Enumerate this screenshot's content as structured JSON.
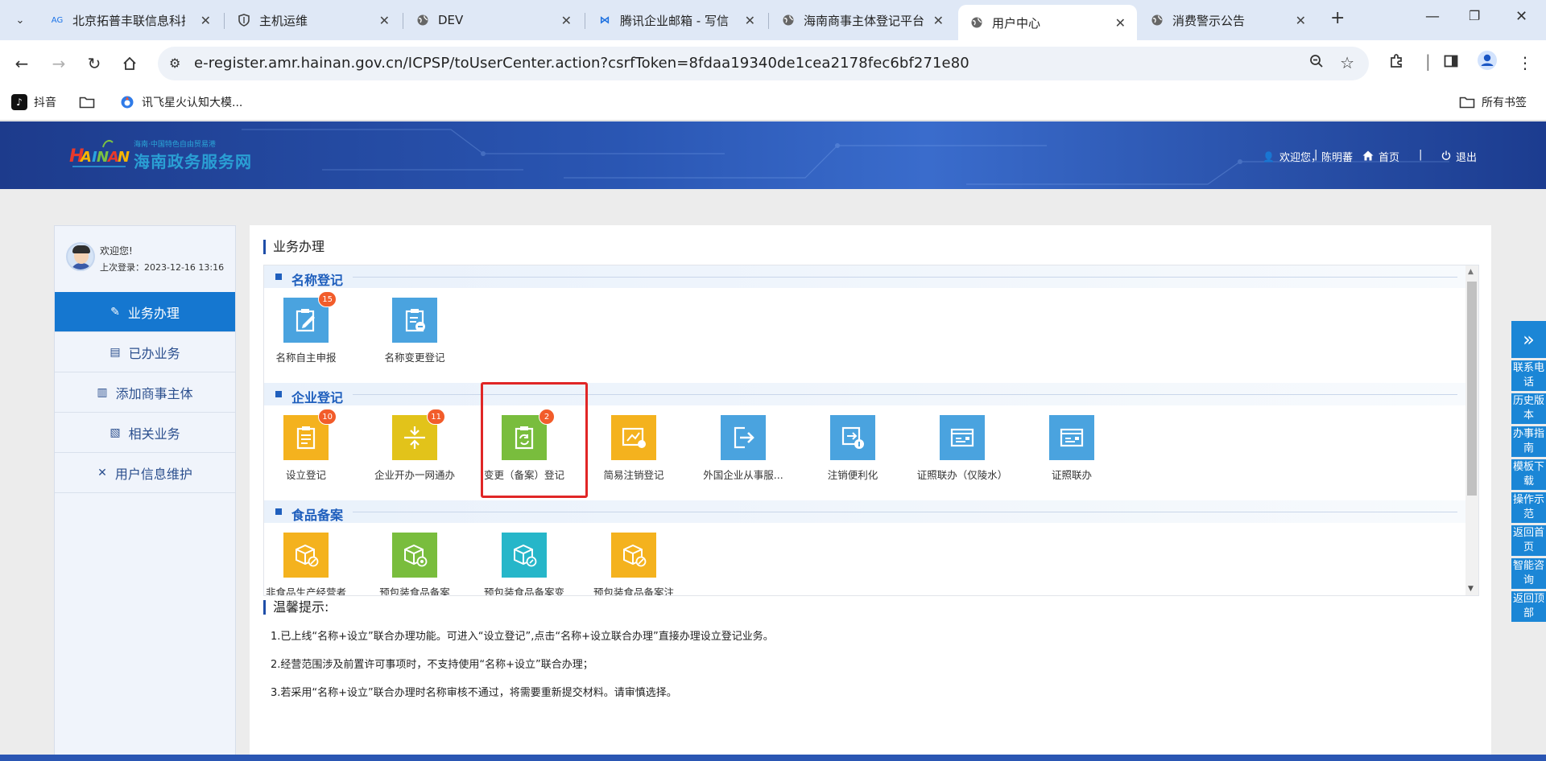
{
  "browser": {
    "tabs": [
      {
        "title": "北京拓普丰联信息科技",
        "icon": "ai-icon"
      },
      {
        "title": "主机运维",
        "icon": "shield-icon"
      },
      {
        "title": "DEV",
        "icon": "globe-icon"
      },
      {
        "title": "腾讯企业邮箱 - 写信",
        "icon": "mail-icon"
      },
      {
        "title": "海南商事主体登记平台",
        "icon": "globe-icon"
      },
      {
        "title": "用户中心",
        "icon": "globe-icon",
        "active": true
      },
      {
        "title": "消费警示公告",
        "icon": "globe-icon"
      }
    ],
    "url": "e-register.amr.hainan.gov.cn/ICPSP/toUserCenter.action?csrfToken=8fdaa19340de1cea2178fec6bf271e80",
    "bookmarks": [
      "抖音",
      "",
      "讯飞星火认知大模..."
    ],
    "all_bookmarks": "所有书签"
  },
  "header": {
    "logo_small": "海南·中国特色自由贸易港",
    "logo_title": "海南政务服务网",
    "welcome": "欢迎您，陈明蕃",
    "home": "首页",
    "logout": "退出",
    "separator": "|"
  },
  "sidebar": {
    "hello": "欢迎您!",
    "last_login": "上次登录：2023-12-16 13:16",
    "items": [
      {
        "label": "业务办理",
        "active": true
      },
      {
        "label": "已办业务"
      },
      {
        "label": "添加商事主体"
      },
      {
        "label": "相关业务"
      },
      {
        "label": "用户信息维护"
      }
    ]
  },
  "content": {
    "title": "业务办理",
    "sections": [
      {
        "title": "名称登记",
        "items": [
          {
            "label": "名称自主申报",
            "badge": "15",
            "color": "#4aa3df"
          },
          {
            "label": "名称变更登记",
            "badge": "",
            "color": "#4aa3df"
          }
        ]
      },
      {
        "title": "企业登记",
        "items": [
          {
            "label": "设立登记",
            "badge": "10",
            "color": "#f4b21e"
          },
          {
            "label": "企业开办一网通办",
            "badge": "11",
            "color": "#e2c31a"
          },
          {
            "label": "变更（备案）登记",
            "badge": "2",
            "color": "#79bd3d"
          },
          {
            "label": "简易注销登记",
            "badge": "",
            "color": "#f4b21e"
          },
          {
            "label": "外国企业从事服...",
            "badge": "",
            "color": "#4aa3df"
          },
          {
            "label": "注销便利化",
            "badge": "",
            "color": "#4aa3df"
          },
          {
            "label": "证照联办（仅陵水）",
            "badge": "",
            "color": "#4aa3df"
          },
          {
            "label": "证照联办",
            "badge": "",
            "color": "#4aa3df"
          }
        ]
      },
      {
        "title": "食品备案",
        "items": [
          {
            "label": "非食品生产经营者",
            "badge": "",
            "color": "#f4b21e"
          },
          {
            "label": "预包装食品备案",
            "badge": "",
            "color": "#79bd3d"
          },
          {
            "label": "预包装食品备案变",
            "badge": "",
            "color": "#26b6c9"
          },
          {
            "label": "预包装食品备案注",
            "badge": "",
            "color": "#f4b21e"
          }
        ]
      }
    ]
  },
  "tips": {
    "title": "温馨提示:",
    "lines": [
      "1.已上线“名称+设立”联合办理功能。可进入“设立登记”,点击“名称+设立联合办理”直接办理设立登记业务。",
      "2.经营范围涉及前置许可事项时，不支持使用“名称+设立”联合办理；",
      "3.若采用“名称+设立”联合办理时名称审核不通过，将需要重新提交材料。请审慎选择。"
    ]
  },
  "float_bar": [
    "联系电话",
    "历史版本",
    "办事指南",
    "模板下载",
    "操作示范",
    "返回首页",
    "智能咨询",
    "返回顶部"
  ]
}
